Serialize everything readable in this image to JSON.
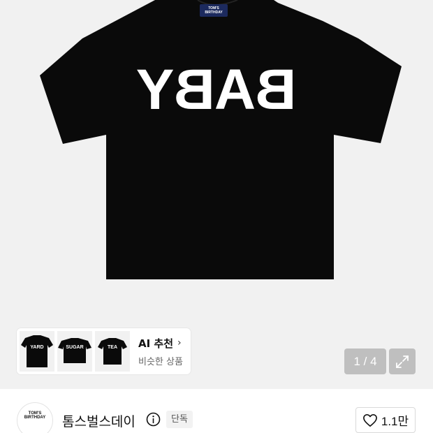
{
  "product": {
    "print_text": "BABY",
    "tag_text": "TOM'S BIRTHDAY"
  },
  "ai_recommend": {
    "title": "AI 추천",
    "subtitle": "비슷한 상품",
    "thumbnails": [
      {
        "label": "YARD"
      },
      {
        "label": "SUGAR"
      },
      {
        "label": "TEA"
      }
    ]
  },
  "pager": {
    "text": "1 / 4"
  },
  "brand": {
    "logo_text": "TOM'S BIRTHDAY",
    "name": "톰스벌스데이",
    "badge": "단독"
  },
  "like": {
    "count": "1.1만"
  },
  "colors": {
    "shirt": "#0a0a0a",
    "background": "#f1f1f1"
  }
}
